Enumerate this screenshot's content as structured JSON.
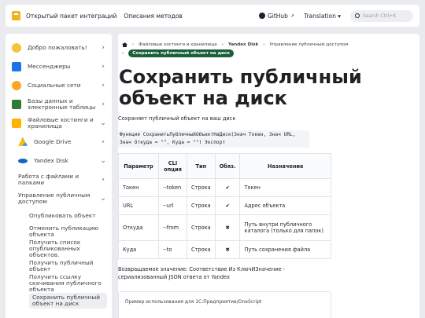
{
  "nav": {
    "items": [
      "Открытый пакет интеграций",
      "Описания методов"
    ],
    "github": "GitHub",
    "translation": "Translation ▾",
    "search_placeholder": "Search Ctrl+K"
  },
  "sidebar": {
    "items": [
      {
        "label": "Добро пожаловать!",
        "icon": "hand-wave-icon",
        "chevron": "›"
      },
      {
        "label": "Мессенджеры",
        "icon": "chat-icon",
        "chevron": "›"
      },
      {
        "label": "Социальные сети",
        "icon": "social-icon",
        "chevron": "›"
      },
      {
        "label": "Базы данных и электронные таблицы",
        "icon": "database-icon",
        "chevron": "›"
      },
      {
        "label": "Файловые хостинги и хранилища",
        "icon": "folder-icon",
        "chevron": "⌄"
      }
    ],
    "sub_items": [
      {
        "label": "Google Drive",
        "icon": "google-drive-icon",
        "chevron": "›"
      },
      {
        "label": "Yandex Disk",
        "icon": "yandex-disk-icon",
        "chevron": "⌄"
      }
    ],
    "yandex_items": [
      {
        "label": "Работа с файлами и папками",
        "chevron": "›"
      },
      {
        "label": "Управление публичным доступом",
        "chevron": "⌄"
      }
    ],
    "public_items": [
      "Опубликовать объект",
      "Отменить публикацию объекта",
      "Получить список опубликованных объектов.",
      "Получить публичный объект",
      "Получить ссылку скачивания публичного объекта",
      "Сохранить публичный объект на диск"
    ]
  },
  "breadcrumb": {
    "items": [
      "Файловые хостинги и хранилища",
      "Yandex Disk",
      "Управление публичным доступом",
      "Сохранить публичный объект на диск"
    ],
    "separator": "›"
  },
  "page": {
    "title": "Сохранить публичный объект на диск",
    "description": "Сохраняет публичный объект на ваш диск",
    "code": "Функция СохранитьПубличныйОбъектНаДиск(Знач Токен, Знач URL, Знач Откуда = \"\", Куда = \"\") Экспорт",
    "table": {
      "headers": [
        "Параметр",
        "CLI опция",
        "Тип",
        "Обяз.",
        "Назначение"
      ],
      "rows": [
        [
          "Токен",
          "--token",
          "Строка",
          "✔",
          "Токен"
        ],
        [
          "URL",
          "--url",
          "Строка",
          "✔",
          "Адрес объекта"
        ],
        [
          "Откуда",
          "--from",
          "Строка",
          "✖",
          "Путь внутри публичного каталога (только для папок)"
        ],
        [
          "Куда",
          "--to",
          "Строка",
          "✖",
          "Путь сохранения файла"
        ]
      ]
    },
    "return_value": "Возвращаемое значение: Соответствие Из КлючИЗначение - сериализованный JSON ответа от Yandex",
    "example_title": "Пример использования для 1С:Предприятие/OneScript"
  }
}
